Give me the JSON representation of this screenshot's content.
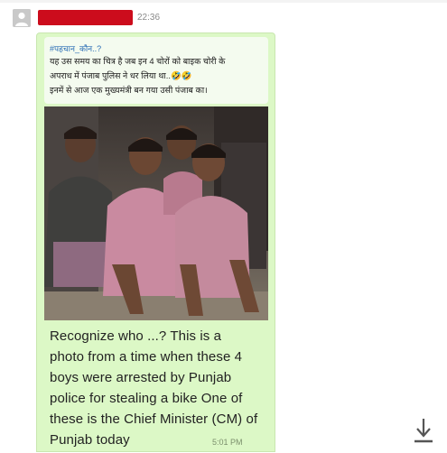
{
  "message": {
    "timestamp": "22:36",
    "hashtag": "#पहचान_कौन..?",
    "hindi_lines": [
      "यह उस समय का चित्र है जब इन 4 चोरों को बाइक चोरी के",
      "अपराध में पंजाब पुलिस ने धर लिया था..🤣🤣",
      "इनमें से आज एक मुख्यमंत्री बन गया उसी पंजाब का।"
    ],
    "caption_lines": [
      "Recognize who ...?   This is a",
      "photo from a time when these 4",
      "boys were arrested by Punjab",
      "police for stealing a bike   One of",
      "these is the Chief Minister (CM) of",
      "Punjab today"
    ],
    "bubble_time": "5:01 PM"
  },
  "icons": {
    "avatar": "avatar-placeholder-icon",
    "download": "download-icon"
  },
  "colors": {
    "bubble": "#dcf8c6",
    "redacted_name": "#cc0c1c",
    "link": "#2a6db5"
  }
}
